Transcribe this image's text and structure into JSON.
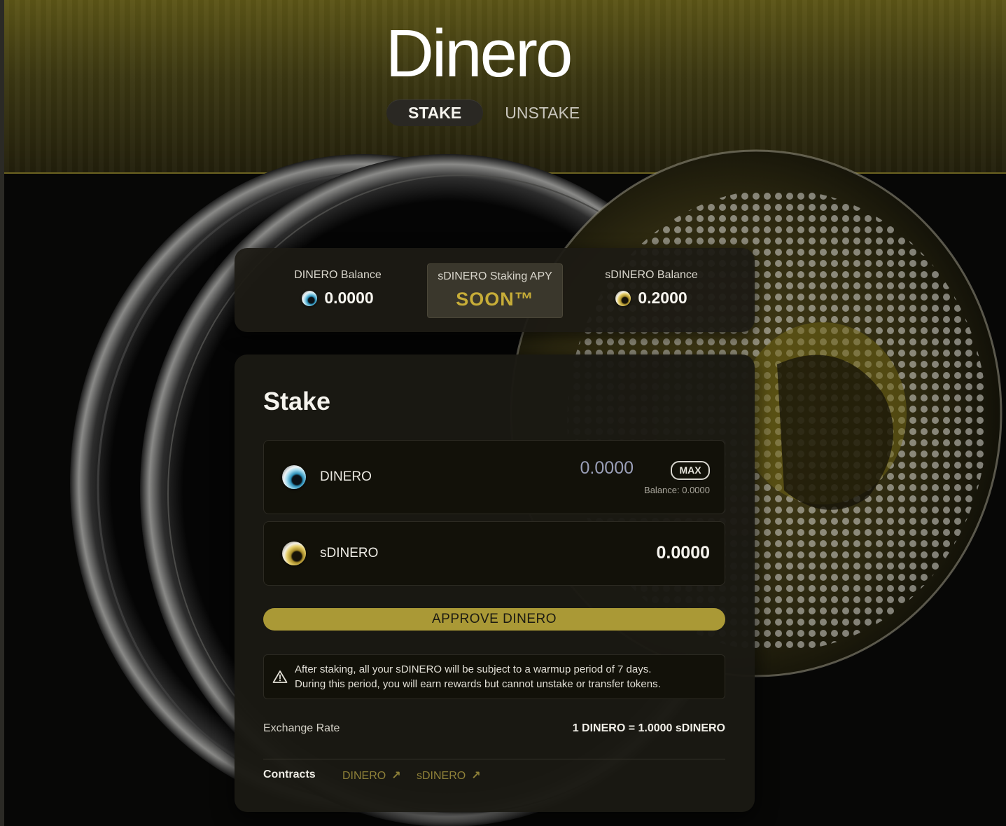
{
  "app": {
    "title": "Dinero"
  },
  "tabs": [
    {
      "label": "STAKE",
      "active": true
    },
    {
      "label": "UNSTAKE",
      "active": false
    }
  ],
  "stats": {
    "dinero_balance": {
      "label": "DINERO Balance",
      "value": "0.0000",
      "icon": "dinero-coin-icon"
    },
    "staking_apy": {
      "label": "sDINERO Staking APY",
      "value": "SOON™"
    },
    "sdinero_balance": {
      "label": "sDINERO Balance",
      "value": "0.2000",
      "icon": "sdinero-coin-icon"
    }
  },
  "stake": {
    "title": "Stake",
    "input_token": {
      "symbol": "DINERO",
      "placeholder": "0.0000",
      "max_label": "MAX",
      "balance_text": "Balance: 0.0000"
    },
    "output_token": {
      "symbol": "sDINERO",
      "amount": "0.0000"
    },
    "approve_label": "APPROVE DINERO",
    "notice": {
      "line1": "After staking, all your sDINERO will be subject to a warmup period of 7 days.",
      "line2": "During this period, you will earn rewards but cannot unstake or transfer tokens."
    },
    "exchange_rate": {
      "label": "Exchange Rate",
      "value": "1 DINERO = 1.0000 sDINERO"
    },
    "contracts": {
      "label": "Contracts",
      "links": [
        "DINERO",
        "sDINERO"
      ]
    }
  },
  "colors": {
    "accent_gold": "#aa9936",
    "apy_text": "#c7ad38",
    "header_band": "#5c5517",
    "card_bg": "#1a1913",
    "page_bg": "#070706"
  }
}
